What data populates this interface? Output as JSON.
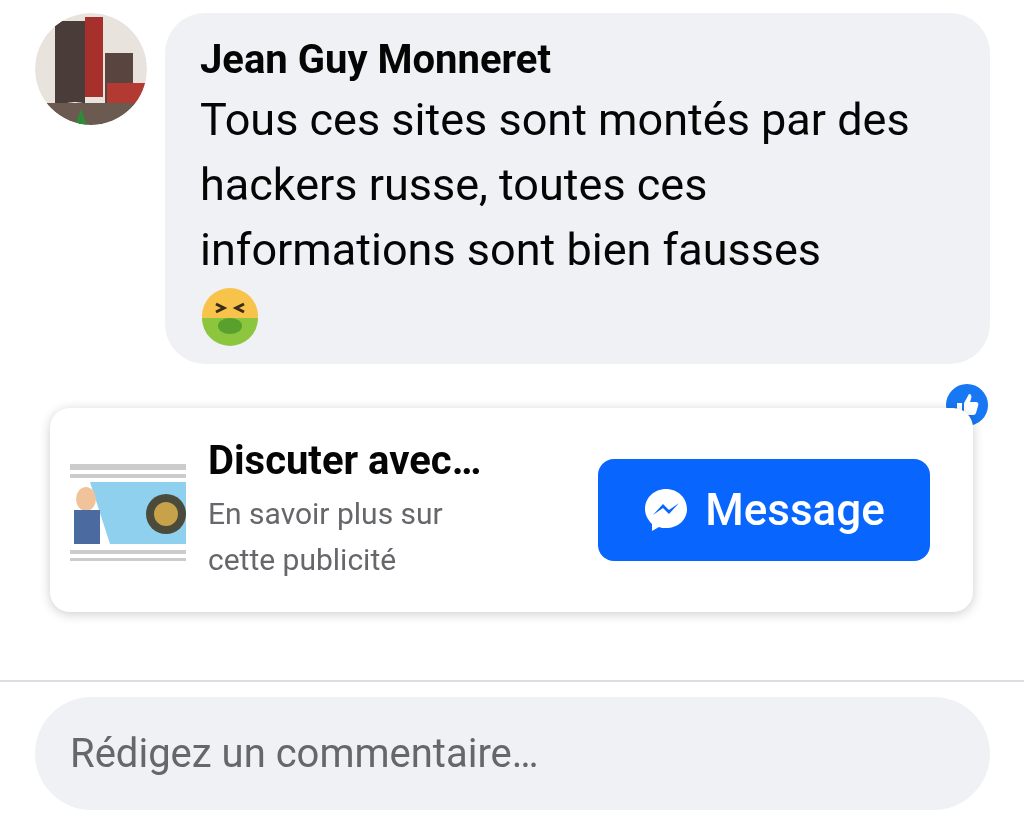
{
  "comment": {
    "author": "Jean Guy Monneret",
    "text": "Tous ces sites sont montés par des hackers russe, toutes ces informations sont bien fausses"
  },
  "ad": {
    "title": "Discuter avec…",
    "subtitle": "En savoir plus sur cette publicité",
    "button": "Message"
  },
  "composer": {
    "placeholder": "Rédigez un commentaire…"
  }
}
